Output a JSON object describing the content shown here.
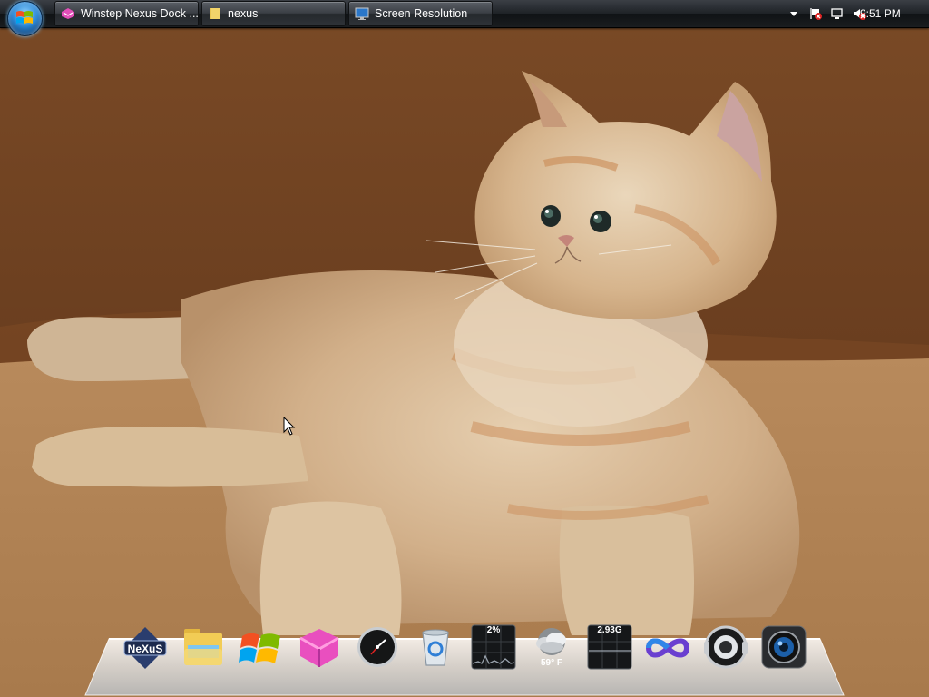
{
  "taskbar": {
    "buttons": [
      {
        "label": "Winstep Nexus Dock ...",
        "icon": "nexus-app-icon"
      },
      {
        "label": "nexus",
        "icon": "folder-icon"
      },
      {
        "label": "Screen Resolution",
        "icon": "monitor-icon"
      }
    ],
    "tray": {
      "icons": [
        "show-hidden-icons-arrow",
        "action-center-flag-icon",
        "network-icon",
        "volume-muted-icon"
      ],
      "clock": "9:51 PM"
    }
  },
  "dock": {
    "items": [
      {
        "name": "nexus-logo-icon",
        "label": ""
      },
      {
        "name": "folder-icon",
        "label": ""
      },
      {
        "name": "windows-logo-icon",
        "label": ""
      },
      {
        "name": "winstep-icon",
        "label": ""
      },
      {
        "name": "clock-icon",
        "label": ""
      },
      {
        "name": "recycle-bin-icon",
        "label": ""
      },
      {
        "name": "cpu-meter-icon",
        "label": "2%"
      },
      {
        "name": "weather-icon",
        "label": "59° F"
      },
      {
        "name": "memory-meter-icon",
        "label": "2.93G"
      },
      {
        "name": "visual-studio-icon",
        "label": ""
      },
      {
        "name": "speaker-icon",
        "label": ""
      },
      {
        "name": "camera-icon",
        "label": ""
      }
    ]
  },
  "colors": {
    "taskbar": "#1e2226",
    "wallpaper_brown": "#6b3f1f",
    "blanket": "#b98a5c"
  }
}
